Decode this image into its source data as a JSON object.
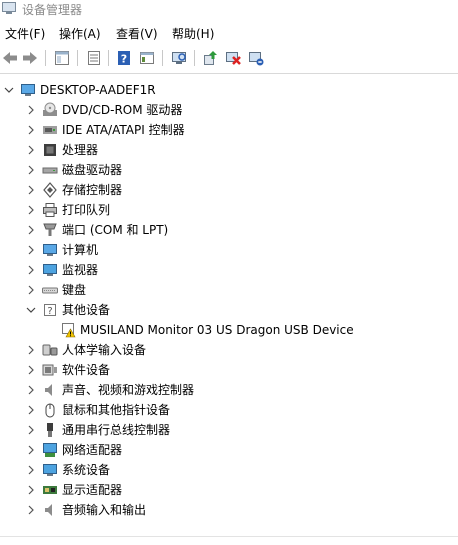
{
  "window": {
    "title": "设备管理器"
  },
  "menu": [
    "文件(F)",
    "操作(A)",
    "查看(V)",
    "帮助(H)"
  ],
  "toolbar": {
    "back": "back-arrow-icon",
    "forward": "forward-arrow-icon",
    "items": [
      "properties-icon",
      "list-icon",
      "help-icon",
      "details-icon",
      "scan-hardware-icon",
      "update-driver-icon",
      "disable-device-icon",
      "uninstall-device-icon"
    ]
  },
  "tree": {
    "root": "DESKTOP-AADEF1R",
    "categories": [
      {
        "label": "DVD/CD-ROM 驱动器",
        "icon": "dvd-icon",
        "expanded": false
      },
      {
        "label": "IDE ATA/ATAPI 控制器",
        "icon": "ide-controller-icon",
        "expanded": false
      },
      {
        "label": "处理器",
        "icon": "processor-icon",
        "expanded": false
      },
      {
        "label": "磁盘驱动器",
        "icon": "disk-drive-icon",
        "expanded": false
      },
      {
        "label": "存储控制器",
        "icon": "storage-controller-icon",
        "expanded": false
      },
      {
        "label": "打印队列",
        "icon": "printer-icon",
        "expanded": false
      },
      {
        "label": "端口 (COM 和 LPT)",
        "icon": "port-icon",
        "expanded": false
      },
      {
        "label": "计算机",
        "icon": "computer-icon",
        "expanded": false
      },
      {
        "label": "监视器",
        "icon": "monitor-icon",
        "expanded": false
      },
      {
        "label": "键盘",
        "icon": "keyboard-icon",
        "expanded": false
      },
      {
        "label": "其他设备",
        "icon": "unknown-device-icon",
        "expanded": true
      },
      {
        "label": "人体学输入设备",
        "icon": "hid-icon",
        "expanded": false
      },
      {
        "label": "软件设备",
        "icon": "software-device-icon",
        "expanded": false
      },
      {
        "label": "声音、视频和游戏控制器",
        "icon": "sound-icon",
        "expanded": false
      },
      {
        "label": "鼠标和其他指针设备",
        "icon": "mouse-icon",
        "expanded": false
      },
      {
        "label": "通用串行总线控制器",
        "icon": "usb-icon",
        "expanded": false
      },
      {
        "label": "网络适配器",
        "icon": "network-adapter-icon",
        "expanded": false
      },
      {
        "label": "系统设备",
        "icon": "system-device-icon",
        "expanded": false
      },
      {
        "label": "显示适配器",
        "icon": "display-adapter-icon",
        "expanded": false
      },
      {
        "label": "音频输入和输出",
        "icon": "audio-io-icon",
        "expanded": false
      }
    ],
    "other_devices_child": {
      "label": "MUSILAND Monitor 03 US Dragon USB Device",
      "icon": "warning-device-icon"
    }
  }
}
